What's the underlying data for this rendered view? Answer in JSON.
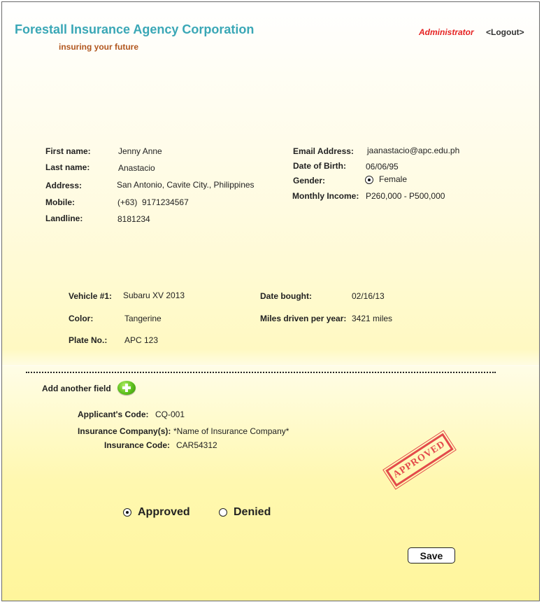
{
  "header": {
    "company": "Forestall Insurance Agency Corporation",
    "tagline": "insuring your future",
    "user_role": "Administrator",
    "logout_label": "<Logout>"
  },
  "personal": {
    "first_name_label": "First name:",
    "first_name": "Jenny Anne",
    "last_name_label": "Last name:",
    "last_name": "Anastacio",
    "address_label": "Address:",
    "address": "San Antonio, Cavite City., Philippines",
    "mobile_label": "Mobile:",
    "mobile": "(+63)  9171234567",
    "landline_label": "Landline:",
    "landline": "8181234",
    "email_label": "Email Address:",
    "email": "jaanastacio@apc.edu.ph",
    "dob_label": "Date of Birth:",
    "dob": "06/06/95",
    "gender_label": "Gender:",
    "gender": "Female",
    "income_label": "Monthly Income:",
    "income": "P260,000 - P500,000"
  },
  "vehicle": {
    "vehicle_label": "Vehicle #1:",
    "vehicle": "Subaru XV 2013",
    "date_bought_label": "Date bought:",
    "date_bought": "02/16/13",
    "color_label": "Color:",
    "color": "Tangerine",
    "miles_label": "Miles driven per year:",
    "miles": "3421 miles",
    "plate_label": "Plate No.:",
    "plate": "APC 123"
  },
  "application": {
    "add_field_label": "Add another field",
    "applicant_code_label": "Applicant's Code:",
    "applicant_code": "CQ-001",
    "company_label": "Insurance Company(s):",
    "company": "*Name of Insurance Company*",
    "insurance_code_label": "Insurance Code:",
    "insurance_code": "CAR54312",
    "stamp_text": "APPROVED"
  },
  "decision": {
    "approved_label": "Approved",
    "denied_label": "Denied",
    "selected": "Approved",
    "save_label": "Save"
  },
  "colors": {
    "brand": "#3aa7b6",
    "tagline": "#b1571f",
    "role": "#e52222",
    "stamp": "#e0383f",
    "plus_icon": "#5cbf1c"
  }
}
